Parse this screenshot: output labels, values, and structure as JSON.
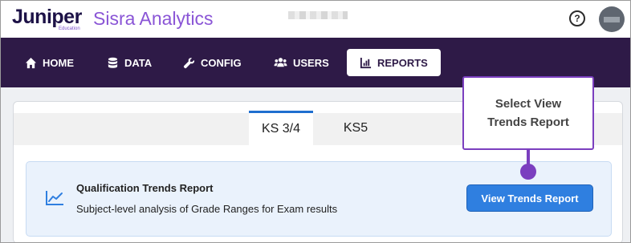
{
  "brand": {
    "name": "Juniper",
    "sub": "Education",
    "app": "Sisra Analytics"
  },
  "header": {
    "help_icon": "question-circle-icon",
    "help_glyph": "?",
    "avatar_icon": "user-avatar"
  },
  "nav": {
    "items": [
      {
        "label": "HOME",
        "icon": "home-icon"
      },
      {
        "label": "DATA",
        "icon": "database-icon"
      },
      {
        "label": "CONFIG",
        "icon": "wrench-icon"
      },
      {
        "label": "USERS",
        "icon": "users-icon"
      },
      {
        "label": "REPORTS",
        "icon": "chart-icon",
        "active": true
      }
    ]
  },
  "tabs": [
    {
      "label": "KS 3/4",
      "active": true
    },
    {
      "label": "KS5",
      "active": false
    }
  ],
  "report": {
    "icon": "line-chart-icon",
    "title": "Qualification Trends Report",
    "description": "Subject-level analysis of Grade Ranges for Exam results",
    "button_label": "View Trends Report"
  },
  "callout": {
    "line1": "Select View",
    "line2": "Trends Report"
  },
  "colors": {
    "nav_bg": "#2e1a47",
    "accent_purple": "#7b3fbf",
    "button_blue": "#2f7fe0",
    "tab_active_border": "#1f6fcf"
  }
}
